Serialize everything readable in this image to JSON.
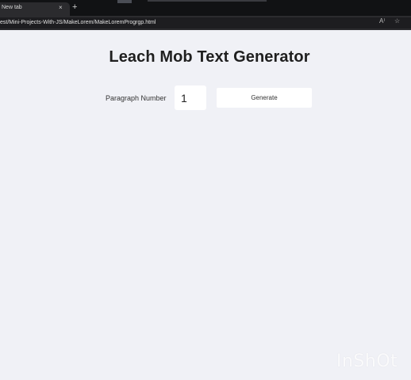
{
  "browser": {
    "tab_title": "New tab",
    "tab_close": "×",
    "new_tab": "+",
    "url": "est/Mini-Projects-With-JS/MakeLorem/MakeLoremProgrgp.html",
    "icons": [
      "read-aloud-icon",
      "favorite-star-icon"
    ]
  },
  "page": {
    "title": "Leach Mob Text Generator",
    "paragraph_label": "Paragraph Number",
    "paragraph_value": "1",
    "generate_label": "Generate"
  },
  "watermark": "InShOt"
}
